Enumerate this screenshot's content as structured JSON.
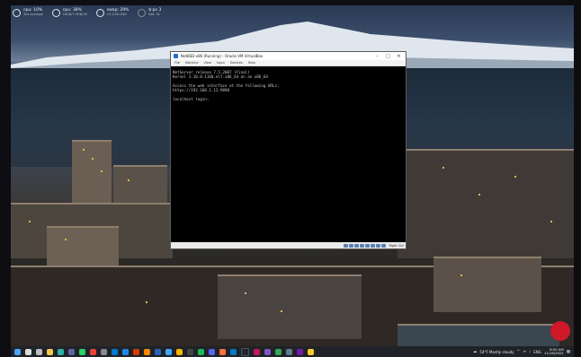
{
  "widgets": [
    {
      "title": "cpu: 10%",
      "sub": "30s average",
      "icon": "cpu-ring-icon"
    },
    {
      "title": "cpu: 38%",
      "sub": "16GB/7.9GB/16",
      "icon": "ram-ring-icon"
    },
    {
      "title": "swap: 29%",
      "sub": "15.2/16.0GB",
      "icon": "swap-ring-icon"
    },
    {
      "title": "b:pc 3",
      "sub": "Bat: 31",
      "icon": "battery-ring-icon"
    }
  ],
  "vm_window": {
    "title": "NetBSD-x86 (Running) - Oracle VM VirtualBox",
    "menu": [
      "File",
      "Machine",
      "View",
      "Input",
      "Devices",
      "Help"
    ],
    "console_lines": [
      "NetServer release 7.5.2007 (Final)",
      "Kernel 3.10.0-1160.el7.x86_64 on an x86_64",
      "",
      "Access the web interface at the following URLs:",
      "https://192.168.1.12:9090",
      "",
      "localhost login:"
    ],
    "status_hostkey": "Right Ctrl"
  },
  "taskbar": {
    "weather": "54°F  Mostly cloudy",
    "lang": "ENG",
    "time": "8:00 AM",
    "date": "11/16/2022"
  }
}
